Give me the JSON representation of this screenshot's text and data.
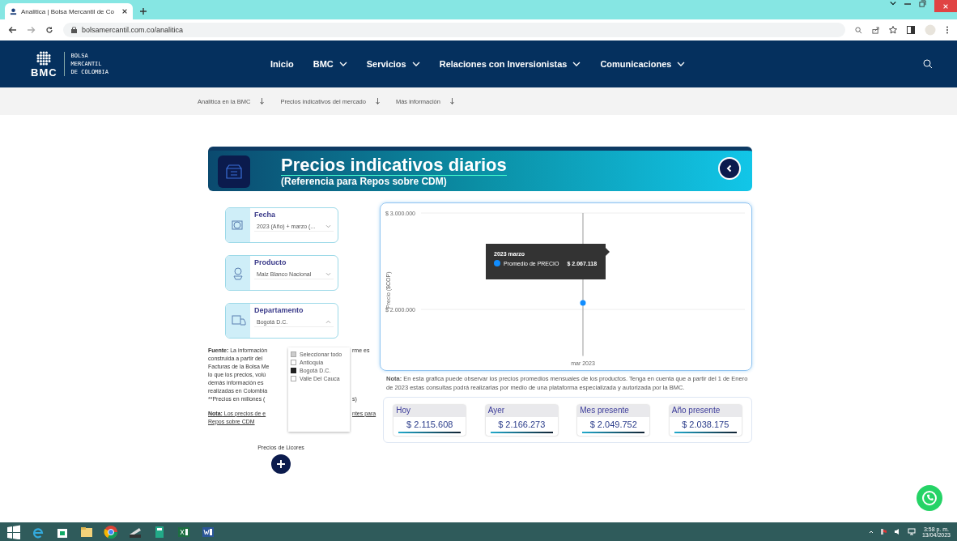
{
  "browser": {
    "tab_title": "Analitica | Bolsa Mercantil de Co",
    "url": "bolsamercantil.com.co/analitica"
  },
  "header": {
    "logo_text": "BMC",
    "logo_lines": [
      "BOLSA",
      "MERCANTIL",
      "DE COLOMBIA"
    ],
    "nav": [
      {
        "label": "Inicio",
        "dropdown": false
      },
      {
        "label": "BMC",
        "dropdown": true
      },
      {
        "label": "Servicios",
        "dropdown": true
      },
      {
        "label": "Relaciones con Inversionistas",
        "dropdown": true
      },
      {
        "label": "Comunicaciones",
        "dropdown": true
      }
    ]
  },
  "subnav": [
    "Analitica en la BMC",
    "Precios indicativos del mercado",
    "Más información"
  ],
  "banner": {
    "title": "Precios indicativos diarios",
    "subtitle": "(Referencia para Repos sobre CDM)"
  },
  "filters": [
    {
      "label": "Fecha",
      "value": "2023 (Año) + marzo (...",
      "expanded": false
    },
    {
      "label": "Producto",
      "value": "Maiz Blanco Nacional",
      "expanded": false
    },
    {
      "label": "Departamento",
      "value": "Bogotá D.C.",
      "expanded": true
    }
  ],
  "dropdown_options": [
    {
      "label": "Seleccionar todo",
      "checked": false,
      "indeterminate": true
    },
    {
      "label": "Antioquia",
      "checked": false,
      "indeterminate": false
    },
    {
      "label": "Bogotá D.C.",
      "checked": true,
      "indeterminate": false
    },
    {
      "label": "Valle Del Cauca",
      "checked": false,
      "indeterminate": false
    }
  ],
  "source_lines": [
    {
      "left": "**Fuente:** La información",
      "right": "rme es"
    },
    {
      "left": "construida a partir del"
    },
    {
      "left": "Facturas de la Bolsa Me"
    },
    {
      "left": "lo que los precios, volú"
    },
    {
      "left": "demás información es"
    },
    {
      "left": "realizadas en Colombia"
    },
    {
      "left": "**Precios en millones (",
      "right": "s)"
    }
  ],
  "note_lines": [
    {
      "left": "**Nota:** Los precios de e",
      "right": "ntes para"
    },
    {
      "left": "Repos sobre CDM"
    }
  ],
  "licores": {
    "label": "Precios de Licores"
  },
  "chart": {
    "chart_data": {
      "type": "line",
      "ylabel": "Precio ($COP)",
      "categories": [
        "mar 2023"
      ],
      "series": [
        {
          "name": "Promedio de PRECIO",
          "color": "#118dff",
          "marker": "circle",
          "values": [
            2067118
          ]
        }
      ],
      "ref_lines": [
        {
          "axis": "y",
          "value": 2000000,
          "color": "#eeeeee"
        },
        {
          "axis": "y",
          "value": 3000000,
          "color": "#eeeeee"
        },
        {
          "axis": "x",
          "value": "mar 2023",
          "color": "#999999"
        }
      ],
      "ylim": [
        1500000,
        3000000
      ],
      "yticks": [
        {
          "value": 2000000,
          "label": "$ 2.000.000"
        },
        {
          "value": 3000000,
          "label": "$ 3.000.000"
        }
      ]
    },
    "tooltip": {
      "title": "2023 marzo",
      "value": "$ 2.067.118"
    }
  },
  "chart_note": "**Nota:** En esta grafica puede observar los precios promedios mensuales de los productos. Tenga en cuenta que a partir del 1 de Enero de 2023 estas consultas podrá realizarlas por medio de una plataforma especializada y autorizada por la BMC.",
  "kpis": [
    {
      "label": "Hoy",
      "value": "$ 2.115.608"
    },
    {
      "label": "Ayer",
      "value": "$ 2.166.273"
    },
    {
      "label": "Mes presente",
      "value": "$ 2.049.752"
    },
    {
      "label": "Año presente",
      "value": "$ 2.038.175"
    }
  ],
  "taskbar": {
    "time": "3:58 p. m.",
    "date": "13/04/2023"
  }
}
